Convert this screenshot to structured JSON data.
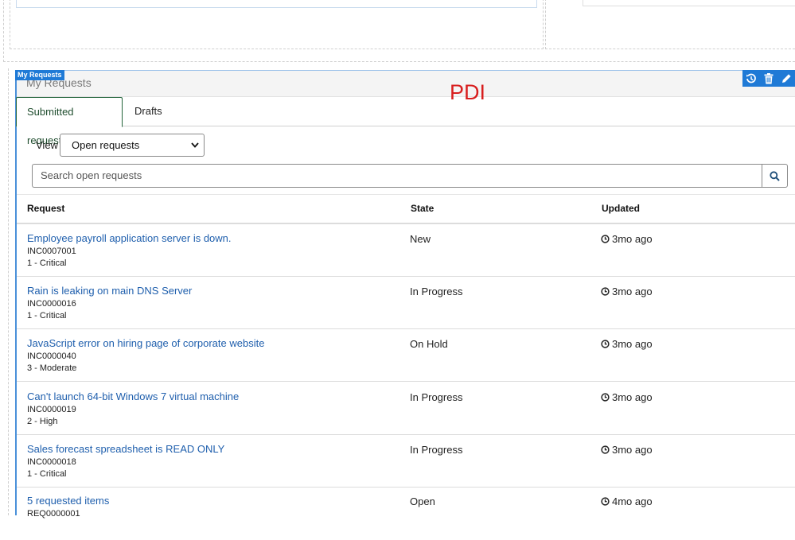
{
  "widget": {
    "tag": "My Requests",
    "title": "My Requests",
    "overlay_text": "PDI",
    "accent_color": "#1f7ad6"
  },
  "toolbar": {
    "icons": [
      "history-icon",
      "trash-icon",
      "pencil-icon"
    ]
  },
  "tabs": [
    {
      "label": "Submitted requests",
      "active": true
    },
    {
      "label": "Drafts",
      "active": false
    }
  ],
  "view": {
    "label": "View",
    "selected": "Open requests"
  },
  "search": {
    "placeholder": "Search open requests",
    "icon": "search-icon"
  },
  "table": {
    "columns": [
      "Request",
      "State",
      "Updated"
    ],
    "rows": [
      {
        "title": "Employee payroll application server is down.",
        "number": "INC0007001",
        "priority": "1 - Critical",
        "state": "New",
        "updated": "3mo ago"
      },
      {
        "title": "Rain is leaking on main DNS Server",
        "number": "INC0000016",
        "priority": "1 - Critical",
        "state": "In Progress",
        "updated": "3mo ago"
      },
      {
        "title": "JavaScript error on hiring page of corporate website",
        "number": "INC0000040",
        "priority": "3 - Moderate",
        "state": "On Hold",
        "updated": "3mo ago"
      },
      {
        "title": "Can't launch 64-bit Windows 7 virtual machine",
        "number": "INC0000019",
        "priority": "2 - High",
        "state": "In Progress",
        "updated": "3mo ago"
      },
      {
        "title": "Sales forecast spreadsheet is READ ONLY",
        "number": "INC0000018",
        "priority": "1 - Critical",
        "state": "In Progress",
        "updated": "3mo ago"
      },
      {
        "title": "5 requested items",
        "number": "REQ0000001",
        "priority": "",
        "state": "Open",
        "updated": "4mo ago"
      }
    ]
  }
}
